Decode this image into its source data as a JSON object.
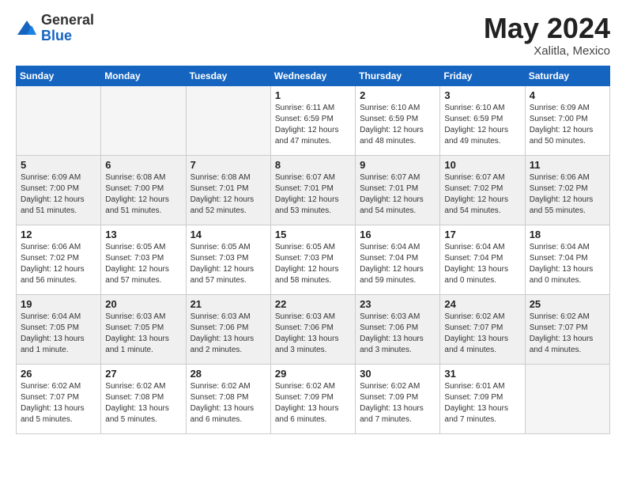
{
  "header": {
    "logo_general": "General",
    "logo_blue": "Blue",
    "month_year": "May 2024",
    "location": "Xalitla, Mexico"
  },
  "days_of_week": [
    "Sunday",
    "Monday",
    "Tuesday",
    "Wednesday",
    "Thursday",
    "Friday",
    "Saturday"
  ],
  "weeks": [
    [
      {
        "day": "",
        "empty": true
      },
      {
        "day": "",
        "empty": true
      },
      {
        "day": "",
        "empty": true
      },
      {
        "day": "1",
        "sunrise": "6:11 AM",
        "sunset": "6:59 PM",
        "daylight": "12 hours and 47 minutes."
      },
      {
        "day": "2",
        "sunrise": "6:10 AM",
        "sunset": "6:59 PM",
        "daylight": "12 hours and 48 minutes."
      },
      {
        "day": "3",
        "sunrise": "6:10 AM",
        "sunset": "6:59 PM",
        "daylight": "12 hours and 49 minutes."
      },
      {
        "day": "4",
        "sunrise": "6:09 AM",
        "sunset": "7:00 PM",
        "daylight": "12 hours and 50 minutes."
      }
    ],
    [
      {
        "day": "5",
        "sunrise": "6:09 AM",
        "sunset": "7:00 PM",
        "daylight": "12 hours and 51 minutes."
      },
      {
        "day": "6",
        "sunrise": "6:08 AM",
        "sunset": "7:00 PM",
        "daylight": "12 hours and 51 minutes."
      },
      {
        "day": "7",
        "sunrise": "6:08 AM",
        "sunset": "7:01 PM",
        "daylight": "12 hours and 52 minutes."
      },
      {
        "day": "8",
        "sunrise": "6:07 AM",
        "sunset": "7:01 PM",
        "daylight": "12 hours and 53 minutes."
      },
      {
        "day": "9",
        "sunrise": "6:07 AM",
        "sunset": "7:01 PM",
        "daylight": "12 hours and 54 minutes."
      },
      {
        "day": "10",
        "sunrise": "6:07 AM",
        "sunset": "7:02 PM",
        "daylight": "12 hours and 54 minutes."
      },
      {
        "day": "11",
        "sunrise": "6:06 AM",
        "sunset": "7:02 PM",
        "daylight": "12 hours and 55 minutes."
      }
    ],
    [
      {
        "day": "12",
        "sunrise": "6:06 AM",
        "sunset": "7:02 PM",
        "daylight": "12 hours and 56 minutes."
      },
      {
        "day": "13",
        "sunrise": "6:05 AM",
        "sunset": "7:03 PM",
        "daylight": "12 hours and 57 minutes."
      },
      {
        "day": "14",
        "sunrise": "6:05 AM",
        "sunset": "7:03 PM",
        "daylight": "12 hours and 57 minutes."
      },
      {
        "day": "15",
        "sunrise": "6:05 AM",
        "sunset": "7:03 PM",
        "daylight": "12 hours and 58 minutes."
      },
      {
        "day": "16",
        "sunrise": "6:04 AM",
        "sunset": "7:04 PM",
        "daylight": "12 hours and 59 minutes."
      },
      {
        "day": "17",
        "sunrise": "6:04 AM",
        "sunset": "7:04 PM",
        "daylight": "13 hours and 0 minutes."
      },
      {
        "day": "18",
        "sunrise": "6:04 AM",
        "sunset": "7:04 PM",
        "daylight": "13 hours and 0 minutes."
      }
    ],
    [
      {
        "day": "19",
        "sunrise": "6:04 AM",
        "sunset": "7:05 PM",
        "daylight": "13 hours and 1 minute."
      },
      {
        "day": "20",
        "sunrise": "6:03 AM",
        "sunset": "7:05 PM",
        "daylight": "13 hours and 1 minute."
      },
      {
        "day": "21",
        "sunrise": "6:03 AM",
        "sunset": "7:06 PM",
        "daylight": "13 hours and 2 minutes."
      },
      {
        "day": "22",
        "sunrise": "6:03 AM",
        "sunset": "7:06 PM",
        "daylight": "13 hours and 3 minutes."
      },
      {
        "day": "23",
        "sunrise": "6:03 AM",
        "sunset": "7:06 PM",
        "daylight": "13 hours and 3 minutes."
      },
      {
        "day": "24",
        "sunrise": "6:02 AM",
        "sunset": "7:07 PM",
        "daylight": "13 hours and 4 minutes."
      },
      {
        "day": "25",
        "sunrise": "6:02 AM",
        "sunset": "7:07 PM",
        "daylight": "13 hours and 4 minutes."
      }
    ],
    [
      {
        "day": "26",
        "sunrise": "6:02 AM",
        "sunset": "7:07 PM",
        "daylight": "13 hours and 5 minutes."
      },
      {
        "day": "27",
        "sunrise": "6:02 AM",
        "sunset": "7:08 PM",
        "daylight": "13 hours and 5 minutes."
      },
      {
        "day": "28",
        "sunrise": "6:02 AM",
        "sunset": "7:08 PM",
        "daylight": "13 hours and 6 minutes."
      },
      {
        "day": "29",
        "sunrise": "6:02 AM",
        "sunset": "7:09 PM",
        "daylight": "13 hours and 6 minutes."
      },
      {
        "day": "30",
        "sunrise": "6:02 AM",
        "sunset": "7:09 PM",
        "daylight": "13 hours and 7 minutes."
      },
      {
        "day": "31",
        "sunrise": "6:01 AM",
        "sunset": "7:09 PM",
        "daylight": "13 hours and 7 minutes."
      },
      {
        "day": "",
        "empty": true
      }
    ]
  ]
}
